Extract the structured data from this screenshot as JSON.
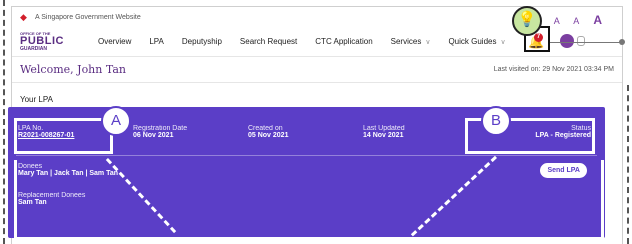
{
  "gov_banner": {
    "text": "A Singapore Government Website",
    "font_sizes": "A A A"
  },
  "logo": {
    "line1": "OFFICE OF THE",
    "line2": "PUBLIC",
    "line3": "GUARDIAN"
  },
  "nav": {
    "items": [
      {
        "label": "Overview"
      },
      {
        "label": "LPA"
      },
      {
        "label": "Deputyship"
      },
      {
        "label": "Search Request"
      },
      {
        "label": "CTC Application"
      },
      {
        "label": "Services",
        "dropdown": true
      },
      {
        "label": "Quick Guides",
        "dropdown": true
      }
    ],
    "notification_count": "7"
  },
  "welcome": {
    "greeting": "Welcome, John Tan",
    "last_visited": "Last visited on: 29 Nov 2021 03:34 PM"
  },
  "section": {
    "title": "Your LPA"
  },
  "lpa_card": {
    "lpa_no_label": "LPA No.",
    "lpa_no": "R2021-008267-01",
    "registration_label": "Registration Date",
    "registration_date": "06 Nov 2021",
    "created_label": "Created on",
    "created_date": "05 Nov 2021",
    "updated_label": "Last Updated",
    "updated_date": "14 Nov 2021",
    "status_label": "Status",
    "status_value": "LPA - Registered",
    "donees_label": "Donees",
    "donees": "Mary Tan  |  Jack Tan  |  Sam Tan",
    "replacement_label": "Replacement Donees",
    "replacement": "Sam Tan",
    "send_button": "Send LPA"
  },
  "annotations": {
    "a": "A",
    "b": "B",
    "bulb": "💡"
  },
  "colors": {
    "brand_purple": "#5a2d82",
    "card_purple": "#5b3ec7",
    "alert_red": "#d21e2b",
    "bulb_green": "#c8e6a0"
  }
}
